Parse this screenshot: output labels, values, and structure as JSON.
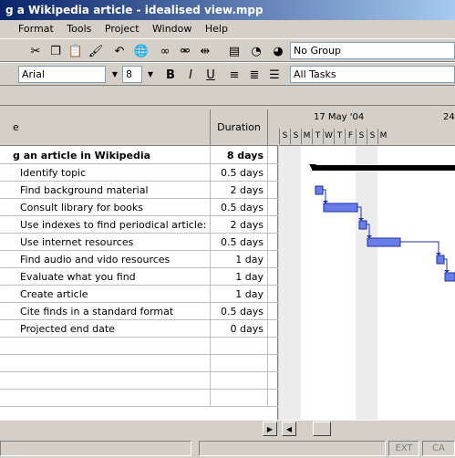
{
  "window": {
    "title": "g a Wikipedia article - idealised view.mpp"
  },
  "menu": [
    "Format",
    "Tools",
    "Project",
    "Window",
    "Help"
  ],
  "toolbar": {
    "group_select": "No Group",
    "font_select": "Arial",
    "size_select": "8",
    "bold_label": "B",
    "italic_label": "I",
    "underline_label": "U",
    "filter_select": "All Tasks"
  },
  "table": {
    "headers": {
      "name": "e",
      "duration": "Duration"
    },
    "rows": [
      {
        "name": "g an article in Wikipedia",
        "duration": "8 days",
        "summary": true
      },
      {
        "name": "Identify topic",
        "duration": "0.5 days"
      },
      {
        "name": "Find background material",
        "duration": "2 days"
      },
      {
        "name": "Consult library for books",
        "duration": "0.5 days"
      },
      {
        "name": "Use indexes to find periodical article:",
        "duration": "2 days"
      },
      {
        "name": "Use internet resources",
        "duration": "0.5 days"
      },
      {
        "name": "Find audio and vido resources",
        "duration": "1 day"
      },
      {
        "name": "Evaluate what you find",
        "duration": "1 day"
      },
      {
        "name": "Create article",
        "duration": "1 day"
      },
      {
        "name": "Cite finds in a standard format",
        "duration": "0.5 days"
      },
      {
        "name": "Projected end date",
        "duration": "0 days"
      }
    ]
  },
  "gantt": {
    "weeks": [
      "17 May '04",
      "24"
    ],
    "days": [
      "S",
      "S",
      "M",
      "T",
      "W",
      "T",
      "F",
      "S",
      "S",
      "M"
    ]
  },
  "statusbar": {
    "ext": "EXT",
    "caps": "CA"
  }
}
